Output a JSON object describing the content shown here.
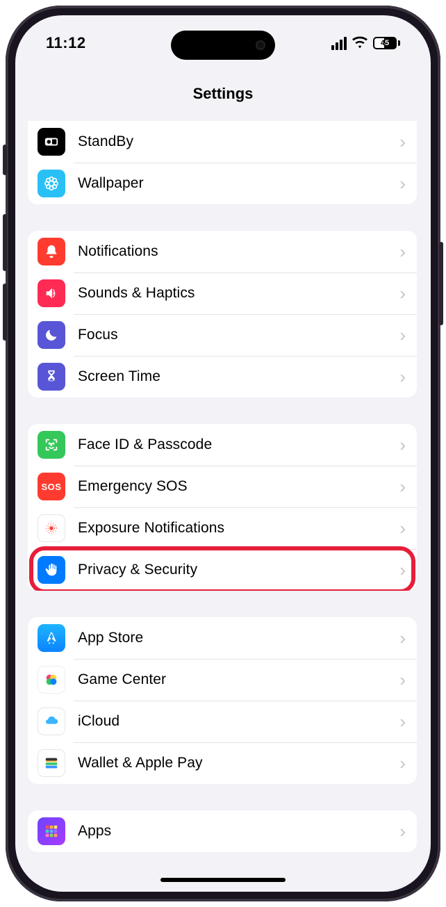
{
  "status": {
    "time": "11:12",
    "battery_percent": "45"
  },
  "nav": {
    "title": "Settings"
  },
  "groups": [
    {
      "id": "display",
      "items": [
        {
          "icon": "standby-icon",
          "iconClass": "bg-black",
          "label": "StandBy"
        },
        {
          "icon": "wallpaper-icon",
          "iconClass": "bg-cyan",
          "label": "Wallpaper"
        }
      ]
    },
    {
      "id": "attention",
      "items": [
        {
          "icon": "bell-icon",
          "iconClass": "bg-red",
          "label": "Notifications"
        },
        {
          "icon": "speaker-icon",
          "iconClass": "bg-pink",
          "label": "Sounds & Haptics"
        },
        {
          "icon": "moon-icon",
          "iconClass": "bg-purple",
          "label": "Focus"
        },
        {
          "icon": "hourglass-icon",
          "iconClass": "bg-purple",
          "label": "Screen Time"
        }
      ]
    },
    {
      "id": "security",
      "items": [
        {
          "icon": "faceid-icon",
          "iconClass": "bg-green",
          "label": "Face ID & Passcode"
        },
        {
          "icon": "sos-icon",
          "iconClass": "bg-sos",
          "label": "Emergency SOS",
          "textIcon": "SOS"
        },
        {
          "icon": "exposure-icon",
          "iconClass": "bg-white",
          "label": "Exposure Notifications"
        },
        {
          "icon": "hand-icon",
          "iconClass": "bg-blue",
          "label": "Privacy & Security",
          "highlighted": true
        }
      ]
    },
    {
      "id": "services",
      "items": [
        {
          "icon": "appstore-icon",
          "iconClass": "bg-appstore",
          "label": "App Store"
        },
        {
          "icon": "gamecenter-icon",
          "iconClass": "bg-gc",
          "label": "Game Center"
        },
        {
          "icon": "icloud-icon",
          "iconClass": "bg-white",
          "label": "iCloud"
        },
        {
          "icon": "wallet-icon",
          "iconClass": "bg-wallet",
          "label": "Wallet & Apple Pay"
        }
      ]
    },
    {
      "id": "apps",
      "items": [
        {
          "icon": "apps-icon",
          "iconClass": "bg-apps",
          "label": "Apps"
        }
      ]
    }
  ],
  "annotation": {
    "highlight_color": "#e61e3a",
    "highlighted_item": "Privacy & Security"
  }
}
